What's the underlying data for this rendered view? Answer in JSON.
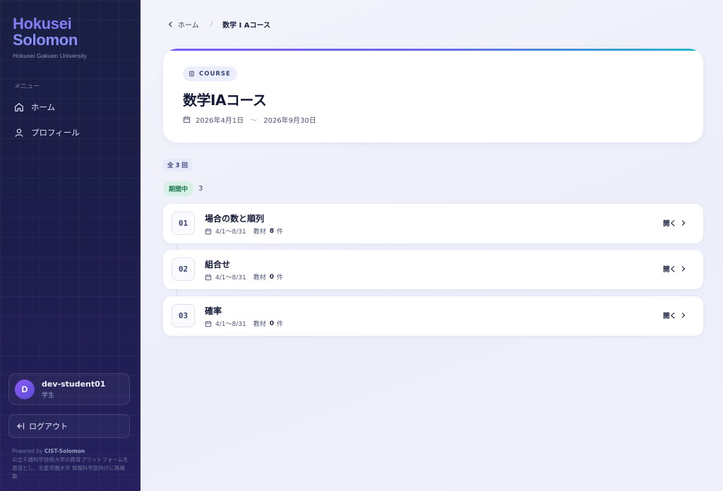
{
  "sidebar": {
    "brand_line1": "Hokusei",
    "brand_line2": "Solomon",
    "brand_sub": "Hokusei Gakuen University",
    "menu_label": "メニュー",
    "items": [
      {
        "label": "ホーム",
        "icon": "home-icon"
      },
      {
        "label": "プロフィール",
        "icon": "user-icon"
      }
    ],
    "user": {
      "initial": "D",
      "name": "dev-student01",
      "role": "学生"
    },
    "logout_label": "ログアウト",
    "powered_prefix": "Powered by ",
    "powered_name": "CIST-Solomon",
    "powered_text": "公立千歳科学技術大学の教育プラットフォームを源流とし、北星学園大学 情報科学部向けに再構築"
  },
  "breadcrumb": {
    "home": "ホーム",
    "separator": "/",
    "current": "数学 I Aコース"
  },
  "course": {
    "badge": "COURSE",
    "title": "数学IAコース",
    "start_date": "2026年4月1日",
    "tilde": "〜",
    "end_date": "2026年9月30日"
  },
  "summary": {
    "total": "全 3 回",
    "status_label": "期間中",
    "status_count": "3"
  },
  "lessons": [
    {
      "num": "01",
      "title": "場合の数と順列",
      "dates": "4/1〜8/31",
      "materials_label": "教材",
      "count": "8",
      "unit": "件",
      "open": "開く"
    },
    {
      "num": "02",
      "title": "組合せ",
      "dates": "4/1〜8/31",
      "materials_label": "教材",
      "count": "0",
      "unit": "件",
      "open": "開く"
    },
    {
      "num": "03",
      "title": "確率",
      "dates": "4/1〜8/31",
      "materials_label": "教材",
      "count": "0",
      "unit": "件",
      "open": "開く"
    }
  ],
  "colors": {
    "sidebar_bg": "#1d1f4a",
    "brand": "#7f7ef4",
    "accent_gradient_start": "#7c5cf0",
    "accent_gradient_end": "#22b8c8",
    "status_bg": "#d8f1e6",
    "status_text": "#1f7a52"
  }
}
